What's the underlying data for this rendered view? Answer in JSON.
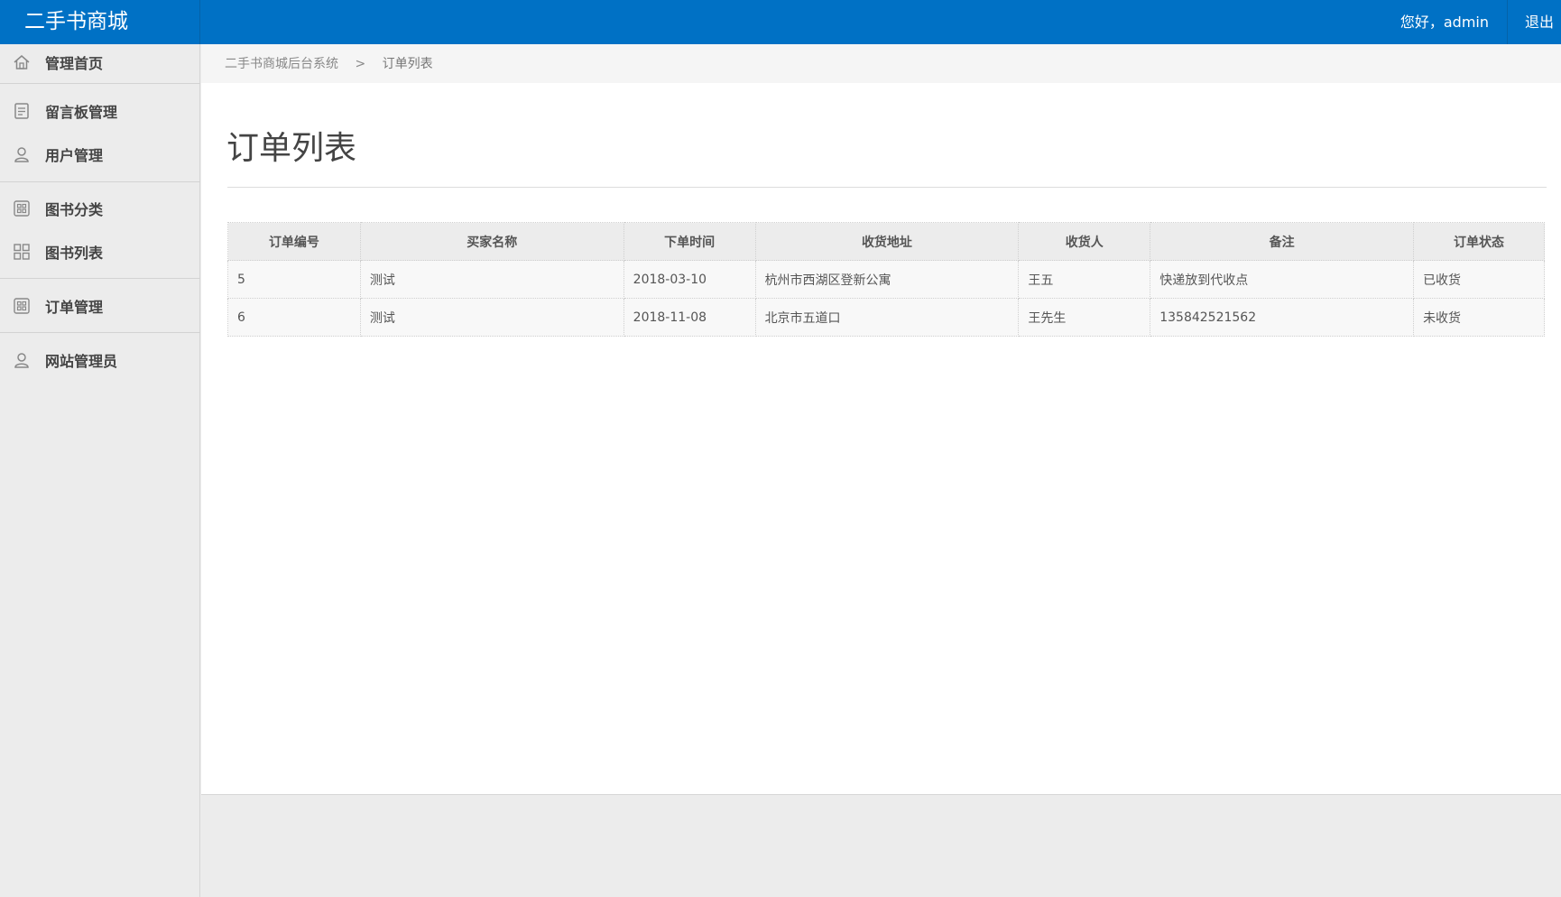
{
  "header": {
    "brand": "二手书商城",
    "greeting": "您好，admin",
    "logout_label": "退出",
    "accent": "#0071c5"
  },
  "sidebar": {
    "items": [
      {
        "label": "管理首页",
        "icon": "home-icon"
      },
      {
        "label": "留言板管理",
        "icon": "document-icon"
      },
      {
        "label": "用户管理",
        "icon": "user-icon"
      },
      {
        "label": "图书分类",
        "icon": "grid-box-icon"
      },
      {
        "label": "图书列表",
        "icon": "grid-icon"
      },
      {
        "label": "订单管理",
        "icon": "grid-box-icon"
      },
      {
        "label": "网站管理员",
        "icon": "user-icon"
      }
    ]
  },
  "breadcrumb": {
    "root": "二手书商城后台系统",
    "separator": ">",
    "current": "订单列表"
  },
  "page": {
    "title": "订单列表"
  },
  "table": {
    "columns": [
      "订单编号",
      "买家名称",
      "下单时间",
      "收货地址",
      "收货人",
      "备注",
      "订单状态"
    ],
    "rows": [
      [
        "5",
        "测试",
        "2018-03-10",
        "杭州市西湖区登新公寓",
        "王五",
        "快递放到代收点",
        "已收货"
      ],
      [
        "6",
        "测试",
        "2018-11-08",
        "北京市五道口",
        "王先生",
        "135842521562",
        "未收货"
      ]
    ]
  }
}
